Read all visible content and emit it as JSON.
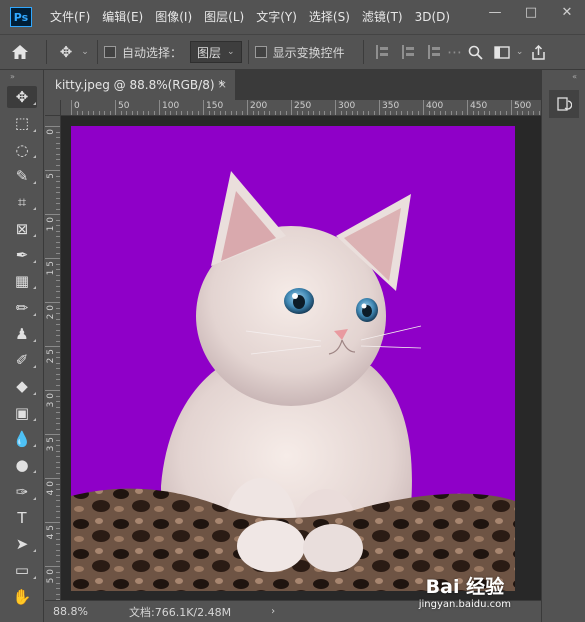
{
  "app": {
    "logo_text": "Ps"
  },
  "menu": [
    "文件(F)",
    "编辑(E)",
    "图像(I)",
    "图层(L)",
    "文字(Y)",
    "选择(S)",
    "滤镜(T)",
    "3D(D)"
  ],
  "window_controls": {
    "minimize": "—",
    "maximize": "□",
    "close": "✕"
  },
  "options": {
    "auto_select_label": "自动选择：",
    "auto_select_checked": false,
    "auto_select_target": "图层",
    "show_transform_label": "显示变换控件",
    "show_transform_checked": false
  },
  "tools": [
    {
      "name": "move-tool",
      "glyph": "✥"
    },
    {
      "name": "marquee-tool",
      "glyph": "⬚"
    },
    {
      "name": "lasso-tool",
      "glyph": "◌"
    },
    {
      "name": "quick-select-tool",
      "glyph": "✎"
    },
    {
      "name": "crop-tool",
      "glyph": "⌗"
    },
    {
      "name": "frame-tool",
      "glyph": "⊠"
    },
    {
      "name": "eyedropper-tool",
      "glyph": "✒"
    },
    {
      "name": "patch-tool",
      "glyph": "▦"
    },
    {
      "name": "brush-tool",
      "glyph": "✏"
    },
    {
      "name": "stamp-tool",
      "glyph": "♟"
    },
    {
      "name": "history-brush-tool",
      "glyph": "✐"
    },
    {
      "name": "eraser-tool",
      "glyph": "◆"
    },
    {
      "name": "gradient-tool",
      "glyph": "▣"
    },
    {
      "name": "blur-tool",
      "glyph": "💧"
    },
    {
      "name": "dodge-tool",
      "glyph": "●"
    },
    {
      "name": "pen-tool",
      "glyph": "✑"
    },
    {
      "name": "type-tool",
      "glyph": "T"
    },
    {
      "name": "path-select-tool",
      "glyph": "➤"
    },
    {
      "name": "rectangle-tool",
      "glyph": "▭"
    },
    {
      "name": "hand-tool",
      "glyph": "✋"
    }
  ],
  "document": {
    "tab_title": "kitty.jpeg @ 88.8%(RGB/8) *",
    "tab_close": "×",
    "zoom": "88.8%",
    "doc_info": "文档:766.1K/2.48M",
    "status_arrow": "›"
  },
  "ruler": {
    "h_labels": [
      "0",
      "50",
      "100",
      "150",
      "200",
      "250",
      "300",
      "350",
      "400",
      "450",
      "500"
    ],
    "v_labels": [
      "0",
      "5",
      "1 0",
      "1 5",
      "2 0",
      "2 5",
      "3 0",
      "3 5",
      "4 0",
      "4 5",
      "5 0"
    ]
  },
  "watermark": {
    "logo": "Bai 经验",
    "url": "jingyan.baidu.com"
  },
  "colors": {
    "background_fill": "#8f00c8",
    "ui_dark": "#535353",
    "canvas_bg": "#282828"
  }
}
